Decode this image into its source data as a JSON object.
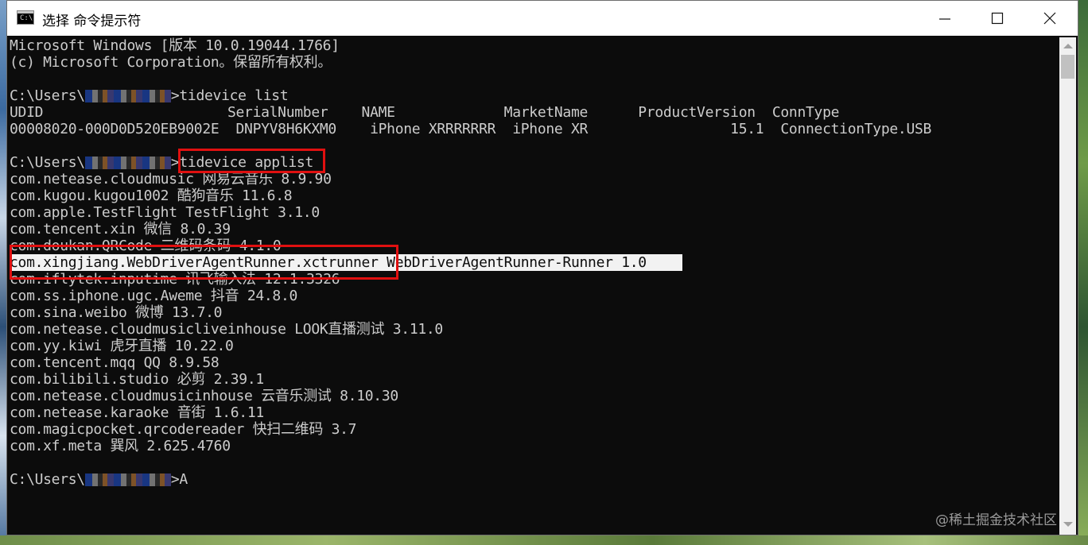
{
  "window": {
    "title": "选择 命令提示符",
    "icon_glyph": "C:\\",
    "controls": {
      "minimize": "minimize-icon",
      "maximize": "maximize-icon",
      "close": "close-icon"
    }
  },
  "console": {
    "lines": [
      "Microsoft Windows [版本 10.0.19044.1766]",
      "(c) Microsoft Corporation。保留所有权利。",
      "",
      "",
      "UDID                      SerialNumber    NAME             MarketName      ProductVersion  ConnType",
      "00008020-000D0D520EB9002E  DNPYV8H6KXM0    iPhone XRRRRRRR  iPhone XR                 15.1  ConnectionType.USB",
      "",
      "",
      "com.netease.cloudmusic 网易云音乐 8.9.90",
      "com.kugou.kugou1002 酷狗音乐 11.6.8",
      "com.apple.TestFlight TestFlight 3.1.0",
      "com.tencent.xin 微信 8.0.39",
      "com.doukan.QRCode 二维码条码 4.1.0",
      "com.xingjiang.WebDriverAgentRunner.xctrunner WebDriverAgentRunner-Runner 1.0",
      "com.iflytek.inputime 讯飞输入法 12.1.3326",
      "com.ss.iphone.ugc.Aweme 抖音 24.8.0",
      "com.sina.weibo 微博 13.7.0",
      "com.netease.cloudmusicliveinhouse LOOK直播测试 3.11.0",
      "com.yy.kiwi 虎牙直播 10.22.0",
      "com.tencent.mqq QQ 8.9.58",
      "com.bilibili.studio 必剪 2.39.1",
      "com.netease.cloudmusicinhouse 云音乐测试 8.10.30",
      "com.netease.karaoke 音街 1.6.11",
      "com.magicpocket.qrcodereader 快扫二维码 3.7",
      "com.xf.meta 巽风 2.625.4760",
      ""
    ],
    "prompt_prefix": "C:\\Users\\",
    "prompt_suffix": ">",
    "prompts": [
      {
        "command": "tidevice list"
      },
      {
        "command": "tidevice applist"
      },
      {
        "command": "A"
      }
    ]
  },
  "watermark": "@稀土掘金技术社区",
  "colors": {
    "console_bg": "#0c0c0c",
    "console_text": "#cccccc",
    "highlight_box": "#e01010",
    "selection_bg": "#f2f2f2"
  }
}
